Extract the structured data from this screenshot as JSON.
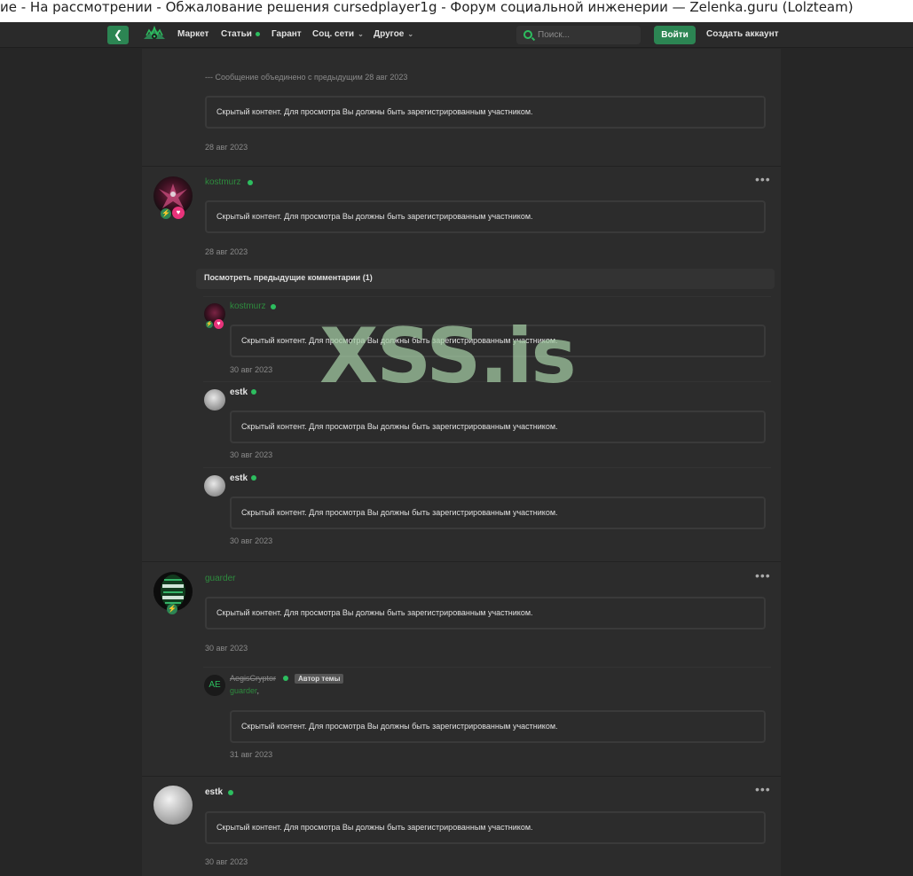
{
  "window": {
    "title": "ие - На рассмотрении - Обжалование решения cursedplayer1g - Форум социальной инженерии — Zelenka.guru (Lolzteam)"
  },
  "nav": {
    "items": [
      {
        "label": "Маркет"
      },
      {
        "label": "Статьи"
      },
      {
        "label": "Гарант"
      },
      {
        "label": "Соц. сети"
      },
      {
        "label": "Другое"
      }
    ],
    "search_placeholder": "Поиск...",
    "login_label": "Войти",
    "register_label": "Создать аккаунт"
  },
  "hidden_text": "Скрытый контент. Для просмотра Вы должны быть зарегистрированным участником.",
  "merged_note": "--- Сообщение объединено с предыдущим 28 авг 2023",
  "prev_comments_label": "Посмотреть предыдущие комментарии (1)",
  "watermark": "XSS.is",
  "posts": [
    {
      "date": "28 авг 2023"
    },
    {
      "username": "kostmurz",
      "date": "28 авг 2023"
    },
    {
      "username": "guarder",
      "date": "30 авг 2023"
    },
    {
      "username": "estk",
      "date": "30 авг 2023"
    }
  ],
  "comments": [
    {
      "username": "kostmurz",
      "date": "30 авг 2023"
    },
    {
      "username": "estk",
      "date": "30 авг 2023"
    },
    {
      "username": "estk",
      "date": "30 авг 2023"
    },
    {
      "username": "AegisCryptor",
      "avatar_initials": "AE",
      "badge": "Автор темы",
      "reply_to": "guarder",
      "reply_tail": ",",
      "date": "31 авг 2023"
    }
  ],
  "colors": {
    "accent": "#2c8553",
    "online": "#2dbe5f",
    "background": "#262626",
    "panel": "#2c2c2c"
  }
}
